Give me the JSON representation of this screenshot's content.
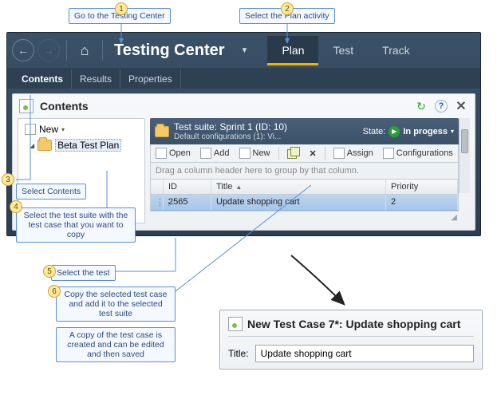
{
  "titlebar": {
    "app_title": "Testing Center",
    "back_icon": "←",
    "fwd_icon": "→",
    "home_icon": "⌂",
    "dropdown_icon": "▼"
  },
  "activities": [
    {
      "label": "Plan",
      "active": true
    },
    {
      "label": "Test",
      "active": false
    },
    {
      "label": "Track",
      "active": false
    }
  ],
  "subtabs": [
    {
      "label": "Contents",
      "active": true
    },
    {
      "label": "Results",
      "active": false
    },
    {
      "label": "Properties",
      "active": false
    }
  ],
  "panel": {
    "title": "Contents",
    "refresh_icon": "↻",
    "help_icon": "?",
    "close_icon": "✕"
  },
  "tree": {
    "new_label": "New",
    "new_drop": "▾",
    "item_expander": "◢",
    "item_label": "Beta Test Plan"
  },
  "suite": {
    "title": "Test suite:  Sprint 1 (ID: 10)",
    "subtitle": "Default configurations (1): Vi...",
    "state_label": "State:",
    "state_value": "In progess",
    "state_drop": "▾",
    "play_glyph": "▶",
    "toolbar": {
      "open": "Open",
      "add": "Add",
      "new": "New",
      "delete_icon": "✕",
      "assign": "Assign",
      "configs": "Configurations"
    },
    "group_hint": "Drag a column header here to group by that column.",
    "columns": {
      "id": "ID",
      "title": "Title",
      "priority": "Priority",
      "sort": "▲"
    },
    "row": {
      "drag": "⋮⋮",
      "id": "2565",
      "title": "Update shopping cart",
      "priority": "2"
    },
    "grip": "◢"
  },
  "new_test_case": {
    "header": "New Test Case 7*: Update shopping cart",
    "title_label": "Title:",
    "title_value": "Update shopping cart"
  },
  "callouts": {
    "c1": "Go to the Testing Center",
    "c2": "Select the Plan activity",
    "c3": "Select Contents",
    "c4": "Select the test suite with the test case that you want to copy",
    "c5": "Select the test",
    "c6": "Copy the selected test case and add it to the selected test suite",
    "c7": "A copy of the test case is created and can be edited and then saved"
  },
  "numbers": {
    "n1": "1",
    "n2": "2",
    "n3": "3",
    "n4": "4",
    "n5": "5",
    "n6": "6"
  }
}
